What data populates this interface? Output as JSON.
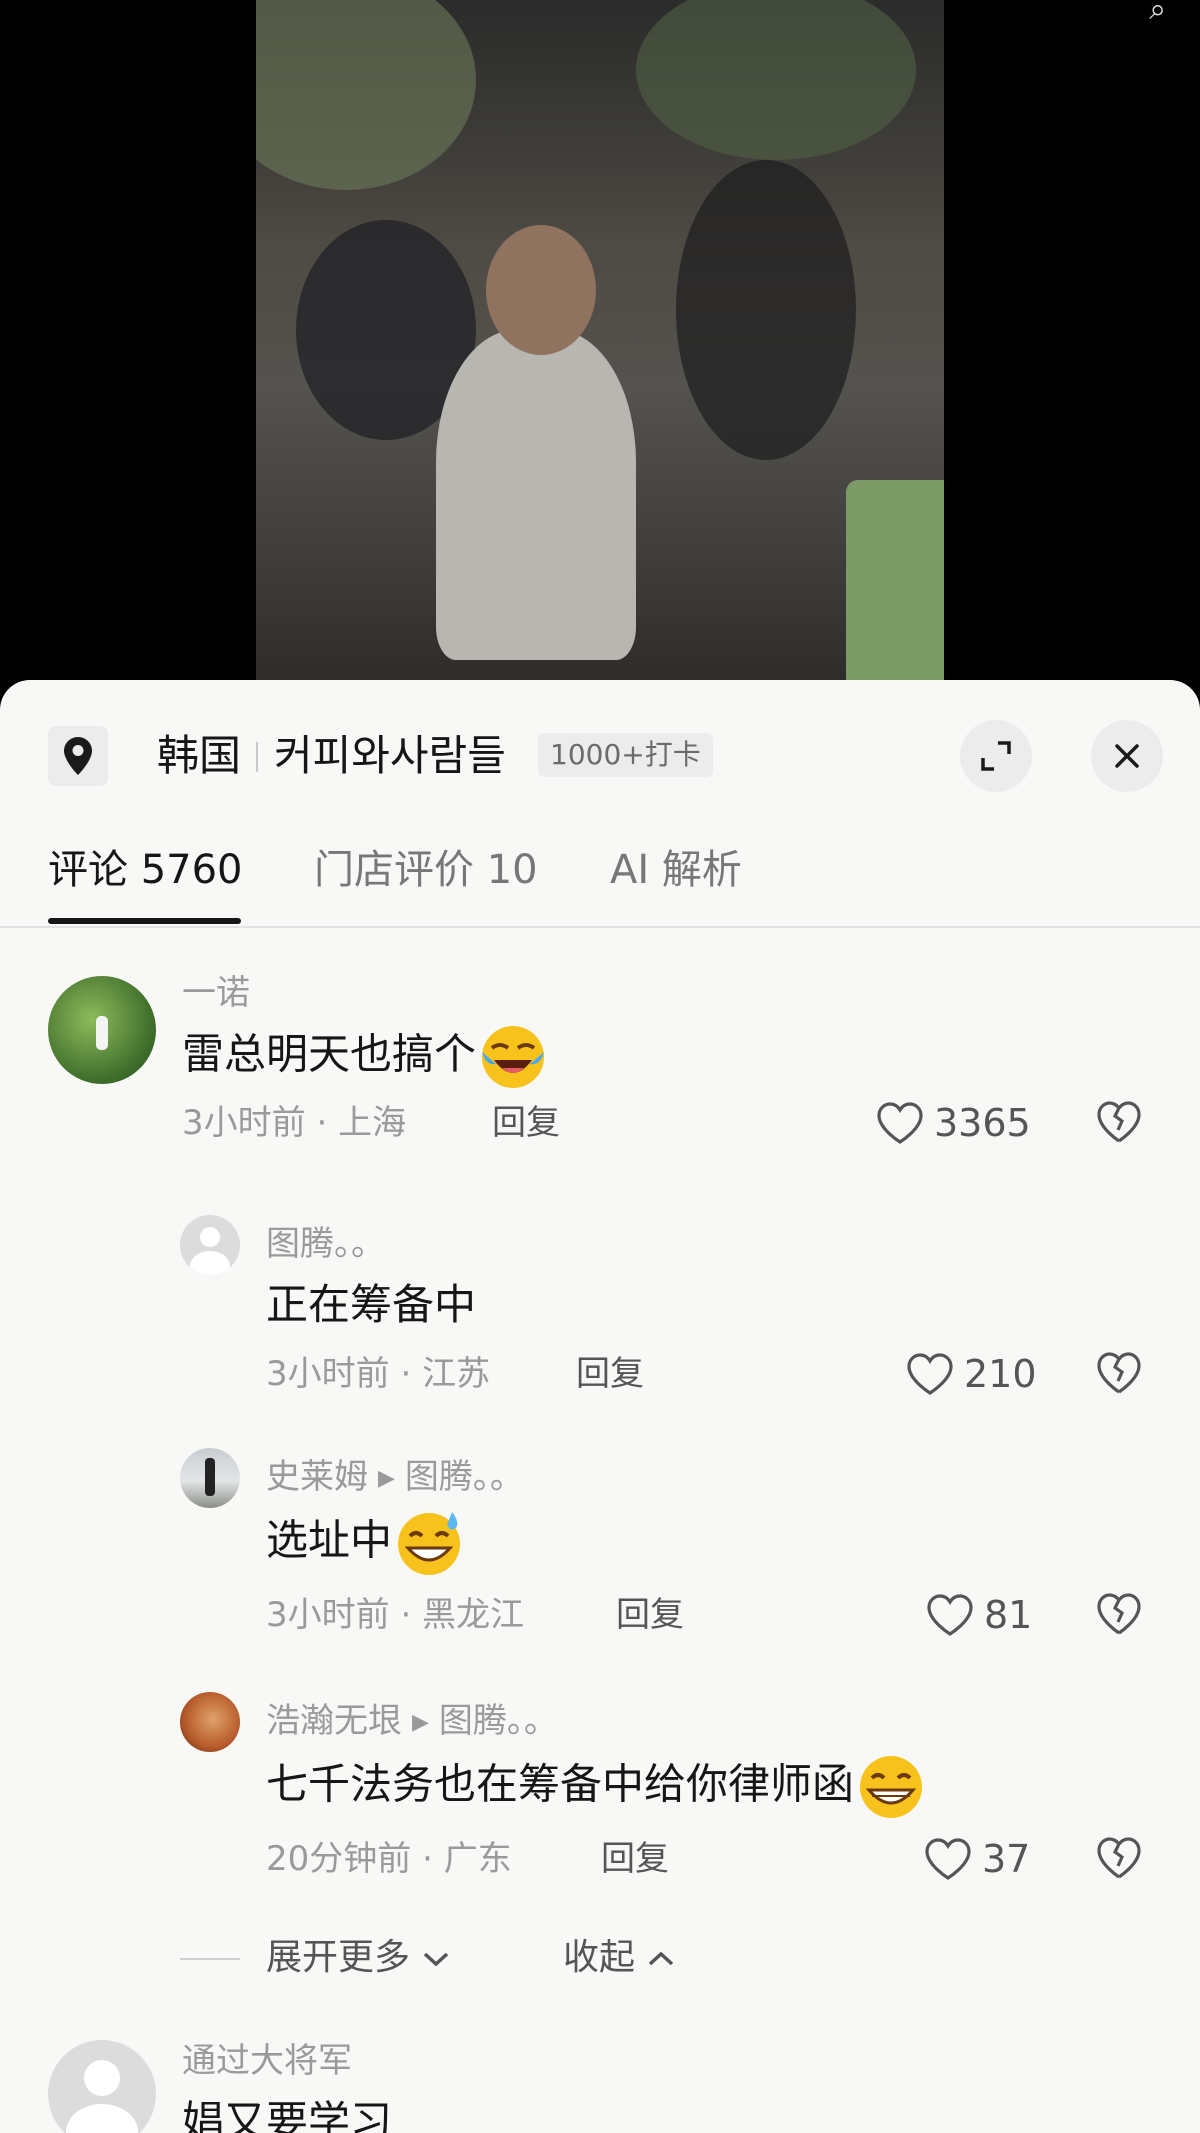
{
  "location": {
    "country": "韩国",
    "name": "커피와사람들",
    "checkins": "1000+打卡"
  },
  "tabs": [
    {
      "label": "评论 5760"
    },
    {
      "label": "门店评价 10"
    },
    {
      "label": "AI 解析"
    }
  ],
  "comments": [
    {
      "user": "一诺",
      "text": "雷总明天也搞个",
      "emoji": "crying-laughing",
      "time": "3小时前",
      "region": "上海",
      "reply": "回复",
      "likes": "3365"
    },
    {
      "user": "图腾。。",
      "text": "正在筹备中",
      "time": "3小时前",
      "region": "江苏",
      "reply": "回复",
      "likes": "210"
    },
    {
      "user": "史莱姆",
      "reply_to": "图腾。。",
      "text": "选址中",
      "emoji": "grinning-sweat",
      "time": "3小时前",
      "region": "黑龙江",
      "reply": "回复",
      "likes": "81"
    },
    {
      "user": "浩瀚无垠",
      "reply_to": "图腾。。",
      "text": "七千法务也在筹备中给你律师函",
      "emoji": "grinning",
      "time": "20分钟前",
      "region": "广东",
      "reply": "回复",
      "likes": "37"
    },
    {
      "user": "通过大将军",
      "text": "娼又要学习"
    }
  ],
  "expand": {
    "more": "展开更多",
    "collapse": "收起"
  },
  "colors": {
    "sheet_bg": "#f8f8f6",
    "text_primary": "#161616",
    "text_secondary": "#9a9a9a"
  }
}
